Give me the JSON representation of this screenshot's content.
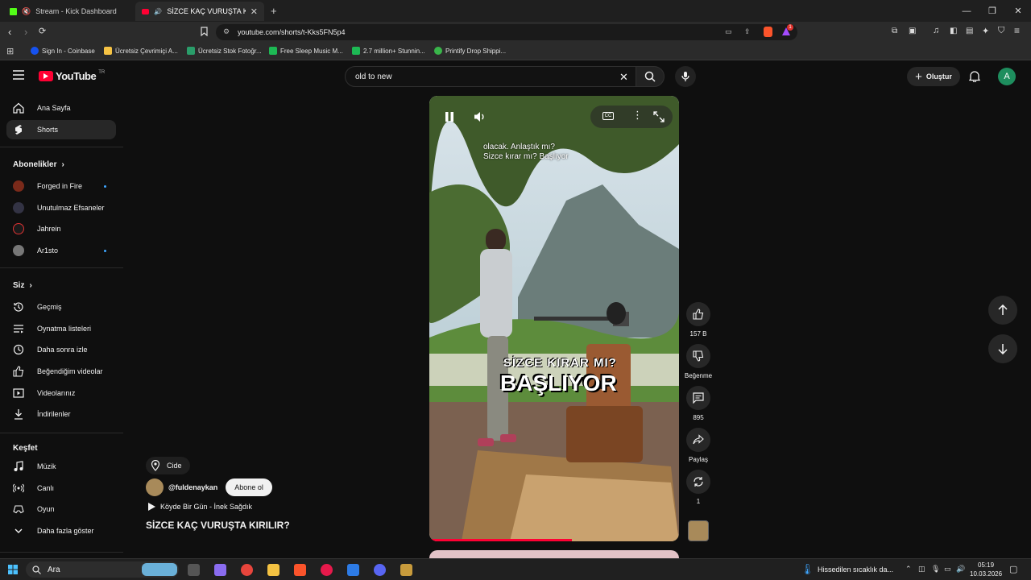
{
  "browser": {
    "tabs": [
      {
        "title": "Stream - Kick Dashboard",
        "active": false
      },
      {
        "title": "SİZCE KAÇ VURUŞTA KIRILIR?",
        "active": true
      }
    ],
    "url": "youtube.com/shorts/t-Kks5FN5p4",
    "bookmarks": [
      "Sign In - Coinbase",
      "Ücretsiz Çevrimiçi A...",
      "Ücretsiz Stok Fotoğr...",
      "Free Sleep Music M...",
      "2.7 million+ Stunnin...",
      "Printify Drop Shippi..."
    ],
    "badge_count": "1"
  },
  "header": {
    "logo": "YouTube",
    "region": "TR",
    "search_query": "old to new",
    "create_label": "Oluştur",
    "avatar_letter": "A"
  },
  "sidebar": {
    "main": [
      {
        "label": "Ana Sayfa"
      },
      {
        "label": "Shorts"
      }
    ],
    "subscriptions_heading": "Abonelikler",
    "subscriptions": [
      {
        "label": "Forged in Fire",
        "new": true
      },
      {
        "label": "Unutulmaz Efsaneler",
        "new": false
      },
      {
        "label": "Jahrein",
        "new": false
      },
      {
        "label": "Ar1sto",
        "new": true
      }
    ],
    "you_heading": "Siz",
    "you": [
      {
        "label": "Geçmiş"
      },
      {
        "label": "Oynatma listeleri"
      },
      {
        "label": "Daha sonra izle"
      },
      {
        "label": "Beğendiğim videolar"
      },
      {
        "label": "Videolarınız"
      },
      {
        "label": "İndirilenler"
      }
    ],
    "explore_heading": "Keşfet",
    "explore": [
      {
        "label": "Müzik"
      },
      {
        "label": "Canlı"
      },
      {
        "label": "Oyun"
      },
      {
        "label": "Daha fazla göster"
      }
    ]
  },
  "short": {
    "caption_line1": "olacak. Anlaştık mı?",
    "caption_line2": "Sizce kırar mı? Başlıyor",
    "overlay_small": "SİZCE KIRAR MI?",
    "overlay_big": "BAŞLIYOR",
    "progress": 0.57,
    "location": "Cide",
    "channel": "@fuldenaykan",
    "subscribe_label": "Abone ol",
    "music": "Köyde Bir Gün - İnek Sağdık",
    "title": "SİZCE KAÇ VURUŞTA KIRILIR?"
  },
  "actions": {
    "likes": "157 B",
    "dislike_label": "Beğenme",
    "comments": "895",
    "share_label": "Paylaş",
    "remix_count": "1"
  },
  "taskbar": {
    "search_label": "Ara",
    "weather": "Hissedilen sıcaklık da...",
    "time": "05:19",
    "date": "10.03.2026"
  },
  "colors": {
    "accent_red": "#ff0033",
    "background": "#0f0f0f",
    "chip": "#272727"
  }
}
